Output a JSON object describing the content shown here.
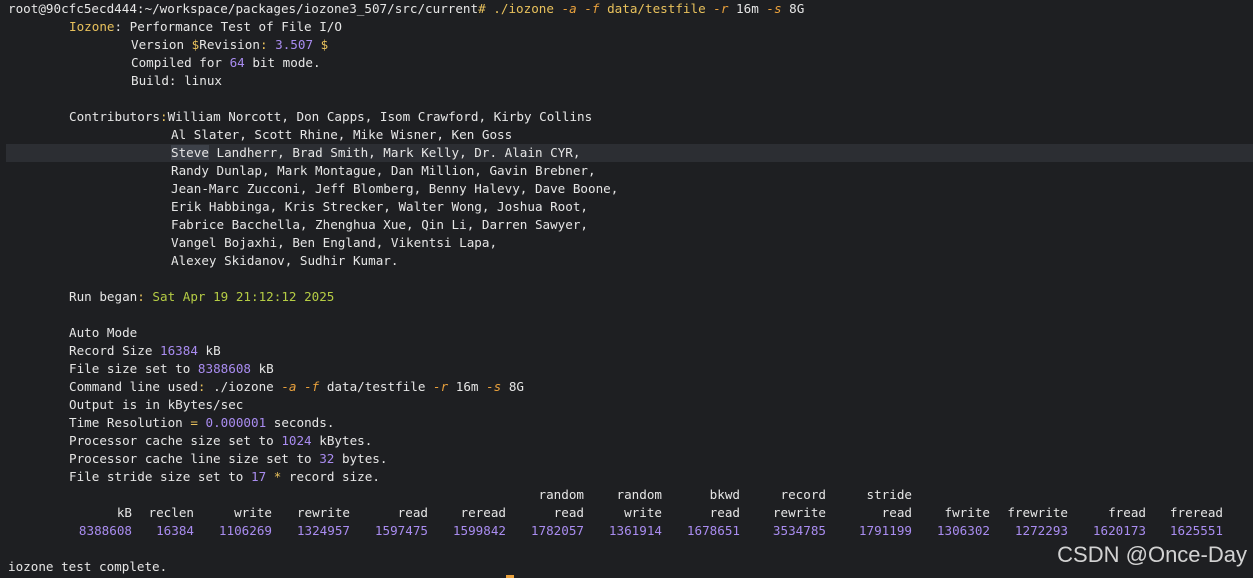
{
  "prompt": {
    "user_host": "root@90cfc5ecd444",
    "path": ":~/workspace/packages/iozone3_507/src/current",
    "symbol": "#",
    "cmd": "./iozone",
    "flag_a": "-a",
    "flag_f": "-f",
    "arg_f": "data/testfile",
    "flag_r": "-r",
    "arg_r": "16m",
    "flag_s": "-s",
    "arg_s": "8G"
  },
  "header": {
    "iozone_label": "Iozone",
    "iozone_rest": ": Performance Test of File I/O",
    "version_a": "Version ",
    "version_dollar": "$",
    "version_b": "Revision",
    "version_colon": ": ",
    "version_num": "3.507",
    "version_end": " $",
    "compiled_a": "Compiled for ",
    "compiled_num": "64",
    "compiled_b": " bit mode.",
    "build_a": "Build",
    "build_b": ": linux"
  },
  "contributors": {
    "label": "Contributors",
    "colon": ":",
    "first": "William Norcott, Don Capps, Isom Crawford, Kirby Collins",
    "lines": [
      "Al Slater, Scott Rhine, Mike Wisner, Ken Goss",
      "Randy Dunlap, Mark Montague, Dan Million, Gavin Brebner,",
      "Jean-Marc Zucconi, Jeff Blomberg, Benny Halevy, Dave Boone,",
      "Erik Habbinga, Kris Strecker, Walter Wong, Joshua Root,",
      "Fabrice Bacchella, Zhenghua Xue, Qin Li, Darren Sawyer,",
      "Vangel Bojaxhi, Ben England, Vikentsi Lapa,",
      "Alexey Skidanov, Sudhir Kumar."
    ],
    "sel_word": "Steve",
    "sel_rest": " Landherr, Brad Smith, Mark Kelly, Dr. Alain CYR,"
  },
  "run": {
    "began_label": "Run began",
    "began_colon": ": ",
    "began_value": "Sat Apr 19 21:12:12 2025"
  },
  "settings": {
    "auto_mode": "Auto Mode",
    "record_a": "Record Size ",
    "record_num": "16384",
    "record_b": " kB",
    "filesize_a": "File size set to ",
    "filesize_num": "8388608",
    "filesize_b": " kB",
    "cmdline_a": "Command line used",
    "cmdline_colon": ": ",
    "cmdline_cmd": "./iozone ",
    "cmdline_fa": "-a",
    "cmdline_sp1": " ",
    "cmdline_ff": "-f",
    "cmdline_file": " data/testfile ",
    "cmdline_fr": "-r",
    "cmdline_rv": " 16m ",
    "cmdline_fs": "-s",
    "cmdline_sv": " 8G",
    "output": "Output is in kBytes/sec",
    "timeres_a": "Time Resolution ",
    "timeres_eq": "=",
    "timeres_sp": " ",
    "timeres_num": "0.000001",
    "timeres_b": " seconds.",
    "cache_a": "Processor cache size set to ",
    "cache_num": "1024",
    "cache_b": " kBytes.",
    "cacheline_a": "Processor cache line size set to ",
    "cacheline_num": "32",
    "cacheline_b": " bytes.",
    "stride_a": "File stride size set to ",
    "stride_num": "17",
    "stride_sp": " ",
    "stride_star": "*",
    "stride_b": " record size."
  },
  "table": {
    "top": [
      "",
      "",
      "",
      "",
      "",
      "",
      "random",
      "random",
      "bkwd",
      "record",
      "stride",
      "",
      "",
      "",
      ""
    ],
    "headers": [
      "kB",
      "reclen",
      "write",
      "rewrite",
      "read",
      "reread",
      "read",
      "write",
      "read",
      "rewrite",
      "read",
      "fwrite",
      "frewrite",
      "fread",
      "freread"
    ],
    "values": [
      "8388608",
      "16384",
      "1106269",
      "1324957",
      "1597475",
      "1599842",
      "1782057",
      "1361914",
      "1678651",
      "3534785",
      "1791199",
      "1306302",
      "1272293",
      "1620173",
      "1625551"
    ]
  },
  "footer": {
    "complete": "iozone test complete.",
    "watermark": "CSDN @Once-Day"
  }
}
